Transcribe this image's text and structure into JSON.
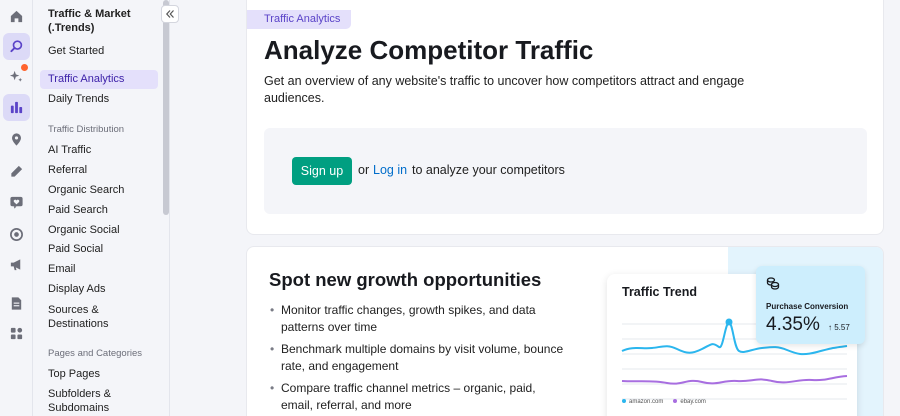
{
  "rail": {
    "icons": [
      "home-icon",
      "search-icon",
      "sparkle-icon",
      "bar-chart-icon",
      "location-pin-icon",
      "pencil-icon",
      "heart-chat-icon",
      "target-icon",
      "megaphone-icon",
      "document-icon",
      "apps-grid-icon"
    ],
    "active": "bar-chart-icon",
    "notification_color": "#ff642d"
  },
  "sidebar": {
    "title": "Traffic & Market (.Trends)",
    "items_top": [
      "Get Started",
      "Traffic Analytics",
      "Daily Trends"
    ],
    "active_item": "Traffic Analytics",
    "group1_label": "Traffic Distribution",
    "group1_items": [
      "AI Traffic",
      "Referral",
      "Organic Search",
      "Paid Search",
      "Organic Social",
      "Paid Social",
      "Email",
      "Display Ads",
      "Sources & Destinations"
    ],
    "group2_label": "Pages and Categories",
    "group2_items": [
      "Top Pages",
      "Subfolders & Subdomains"
    ]
  },
  "hero": {
    "badge": "Traffic Analytics",
    "title": "Analyze Competitor Traffic",
    "description": "Get an overview of any website's traffic to uncover how competitors attract and engage audiences.",
    "signup_label": "Sign up",
    "or_text": "or",
    "login_label": "Log in",
    "cta_tail": "to analyze your competitors",
    "signup_color": "#009f81"
  },
  "growth": {
    "title": "Spot new growth opportunities",
    "bullets": [
      "Monitor traffic changes, growth spikes, and data patterns over time",
      "Benchmark multiple domains by visit volume, bounce rate, and engagement",
      "Compare traffic channel metrics – organic, paid, email, referral, and more"
    ]
  },
  "trend_card": {
    "title": "Traffic Trend",
    "legend": [
      "amazon.com",
      "ebay.com"
    ],
    "colors": [
      "#2bb6ee",
      "#a86ee0"
    ]
  },
  "conversion": {
    "label": "Purchase Conversion",
    "value": "4.35%",
    "delta": "5.57",
    "delta_arrow": "↑"
  }
}
